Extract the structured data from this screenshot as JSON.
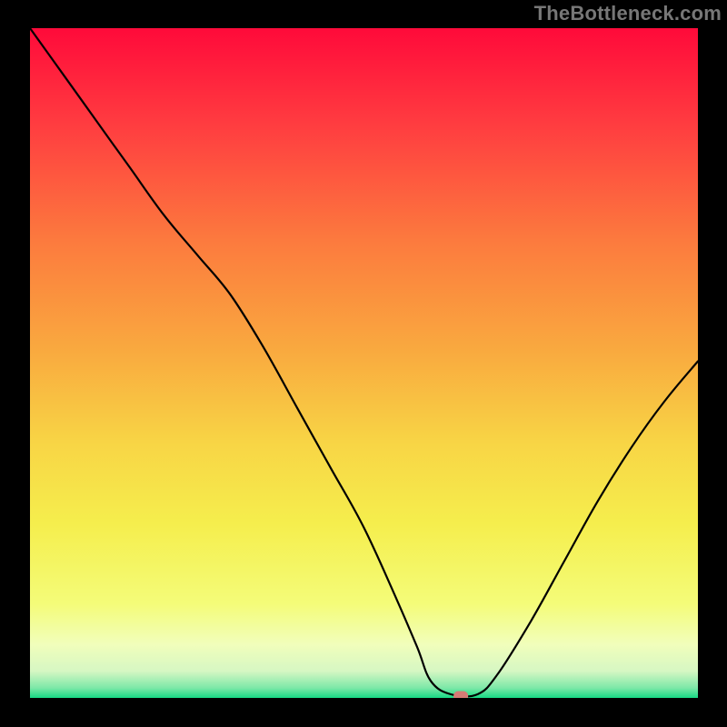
{
  "watermark": "TheBottleneck.com",
  "chart_data": {
    "type": "line",
    "title": "",
    "xlabel": "",
    "ylabel": "",
    "xlim": [
      0,
      100
    ],
    "ylim": [
      0,
      100
    ],
    "grid": false,
    "legend": false,
    "description": "Bottleneck curve: high values at the extremes, dropping to near zero at the optimal point around x≈64; a small green band sits at the very bottom.",
    "series": [
      {
        "name": "bottleneck-curve",
        "x": [
          0,
          5,
          10,
          15,
          20,
          25,
          30,
          35,
          40,
          45,
          50,
          55,
          58,
          60,
          63,
          67,
          70,
          75,
          80,
          85,
          90,
          95,
          100
        ],
        "values": [
          100,
          93,
          86,
          79,
          72,
          66,
          60,
          52,
          43,
          34,
          25,
          14,
          7,
          2,
          0,
          0,
          3,
          11,
          20,
          29,
          37,
          44,
          50
        ]
      }
    ],
    "marker": {
      "x": 64.5,
      "y": 0,
      "color": "#d57b75"
    },
    "background_gradient": {
      "stops": [
        {
          "pos": 0.0,
          "color": "#ff0a3a"
        },
        {
          "pos": 0.14,
          "color": "#ff3b40"
        },
        {
          "pos": 0.32,
          "color": "#fc7b3e"
        },
        {
          "pos": 0.48,
          "color": "#f9a93f"
        },
        {
          "pos": 0.62,
          "color": "#f8d545"
        },
        {
          "pos": 0.74,
          "color": "#f5ee4d"
        },
        {
          "pos": 0.86,
          "color": "#f4fc79"
        },
        {
          "pos": 0.92,
          "color": "#f1febb"
        },
        {
          "pos": 0.96,
          "color": "#d6f7c3"
        },
        {
          "pos": 0.985,
          "color": "#7de8a8"
        },
        {
          "pos": 1.0,
          "color": "#17d984"
        }
      ]
    }
  }
}
